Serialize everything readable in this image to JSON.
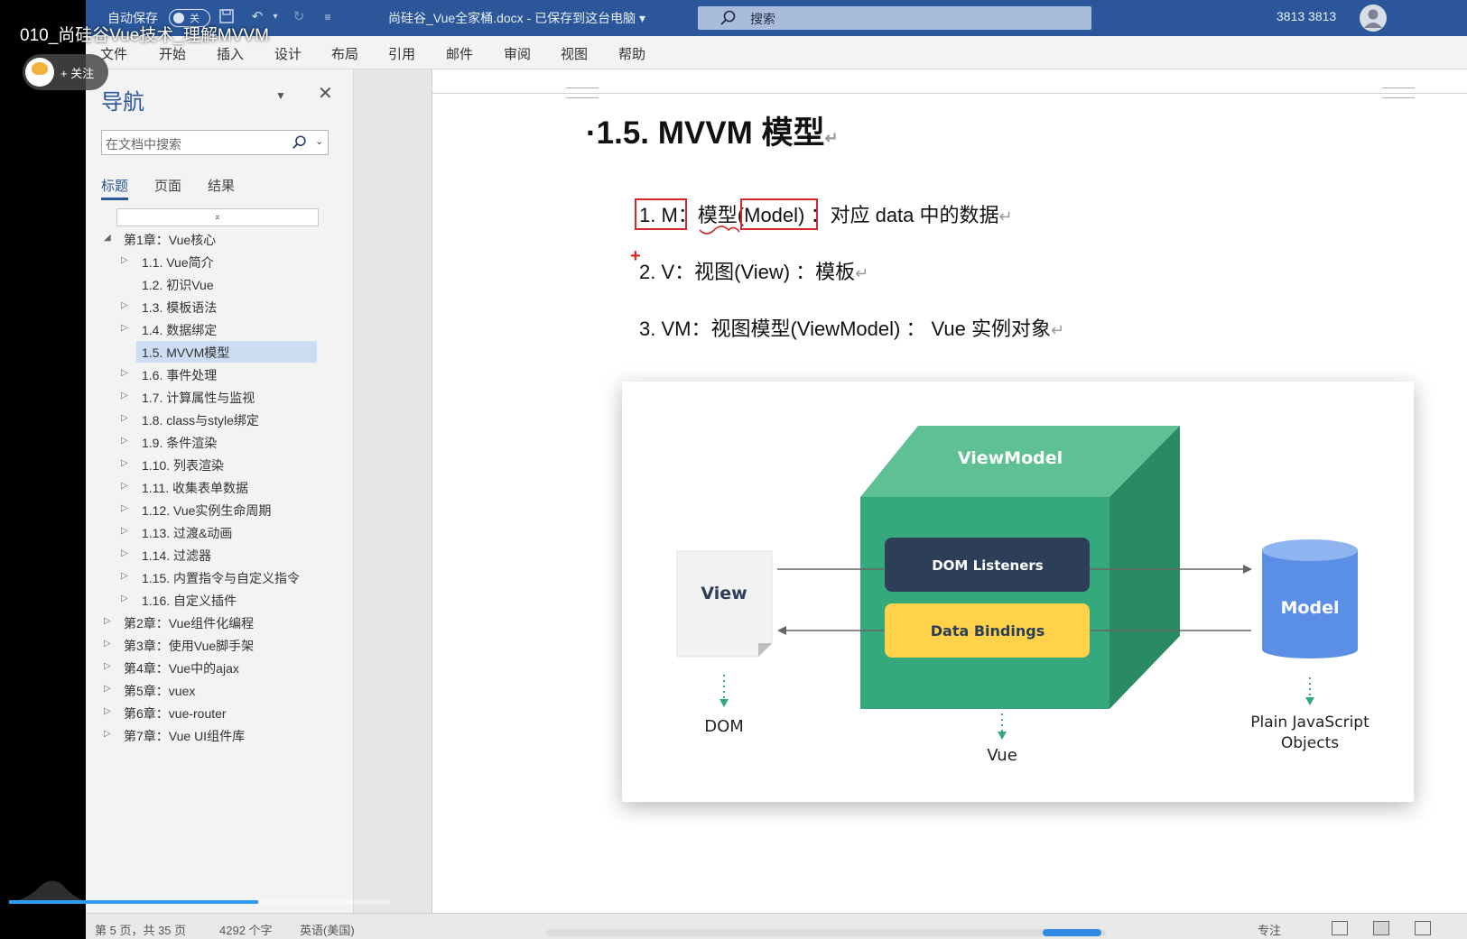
{
  "video": {
    "title": "010_尚硅谷Vue技术_理解MVVM",
    "follow_label": "+ 关注",
    "progress_fraction": 0.65
  },
  "titlebar": {
    "autosave_label": "自动保存",
    "toggle_state": "关",
    "doc_title": "尚硅谷_Vue全家桶.docx - 已保存到这台电脑 ▾",
    "search_placeholder": "搜索",
    "user": "3813 3813"
  },
  "menu": [
    "文件",
    "开始",
    "插入",
    "设计",
    "布局",
    "引用",
    "邮件",
    "审阅",
    "视图",
    "帮助"
  ],
  "nav": {
    "title": "导航",
    "search_placeholder": "在文档中搜索",
    "tabs": [
      "标题",
      "页面",
      "结果"
    ],
    "collapse_symbol": "⌅",
    "items": [
      {
        "label": "第1章：Vue核心",
        "arrow": "◢"
      },
      {
        "label": "1.1. Vue简介",
        "arrow": "▷"
      },
      {
        "label": "1.2. 初识Vue",
        "arrow": ""
      },
      {
        "label": "1.3. 模板语法",
        "arrow": "▷"
      },
      {
        "label": "1.4. 数据绑定",
        "arrow": "▷"
      },
      {
        "label": "1.5. MVVM模型",
        "arrow": ""
      },
      {
        "label": "1.6. 事件处理",
        "arrow": "▷"
      },
      {
        "label": "1.7. 计算属性与监视",
        "arrow": "▷"
      },
      {
        "label": "1.8. class与style绑定",
        "arrow": "▷"
      },
      {
        "label": "1.9. 条件渲染",
        "arrow": "▷"
      },
      {
        "label": "1.10. 列表渲染",
        "arrow": "▷"
      },
      {
        "label": "1.11. 收集表单数据",
        "arrow": "▷"
      },
      {
        "label": "1.12. Vue实例生命周期",
        "arrow": "▷"
      },
      {
        "label": "1.13. 过渡&动画",
        "arrow": "▷"
      },
      {
        "label": "1.14. 过滤器",
        "arrow": "▷"
      },
      {
        "label": "1.15. 内置指令与自定义指令",
        "arrow": "▷"
      },
      {
        "label": "1.16. 自定义插件",
        "arrow": "▷"
      },
      {
        "label": "第2章：Vue组件化编程",
        "arrow": "▷"
      },
      {
        "label": "第3章：使用Vue脚手架",
        "arrow": "▷"
      },
      {
        "label": "第4章：Vue中的ajax",
        "arrow": "▷"
      },
      {
        "label": "第5章：vuex",
        "arrow": "▷"
      },
      {
        "label": "第6章：vue-router",
        "arrow": "▷"
      },
      {
        "label": "第7章：Vue UI组件库",
        "arrow": "▷"
      }
    ]
  },
  "document": {
    "heading": "·1.5. MVVM 模型",
    "para_mark": "↵",
    "lines": [
      "1. M：模型(Model) ：对应 data 中的数据",
      "2. V：视图(View) ：模板",
      "3. VM：视图模型(ViewModel) ：  Vue 实例对象"
    ]
  },
  "diagram": {
    "viewmodel": "ViewModel",
    "dom_listeners": "DOM Listeners",
    "data_bindings": "Data Bindings",
    "view": "View",
    "model": "Model",
    "dom": "DOM",
    "vue": "Vue",
    "plain_js_line1": "Plain JavaScript",
    "plain_js_line2": "Objects",
    "colors": {
      "cube_front": "#35a87c",
      "cube_top": "#5fc096",
      "cube_side": "#2a8a63",
      "listeners": "#2d3e58",
      "bindings": "#ffd24a",
      "model": "#5b8fe6"
    }
  },
  "statusbar": {
    "page": "第 5 页，共 35 页",
    "words": "4292 个字",
    "lang": "英语(美国)",
    "focus": "专注"
  }
}
